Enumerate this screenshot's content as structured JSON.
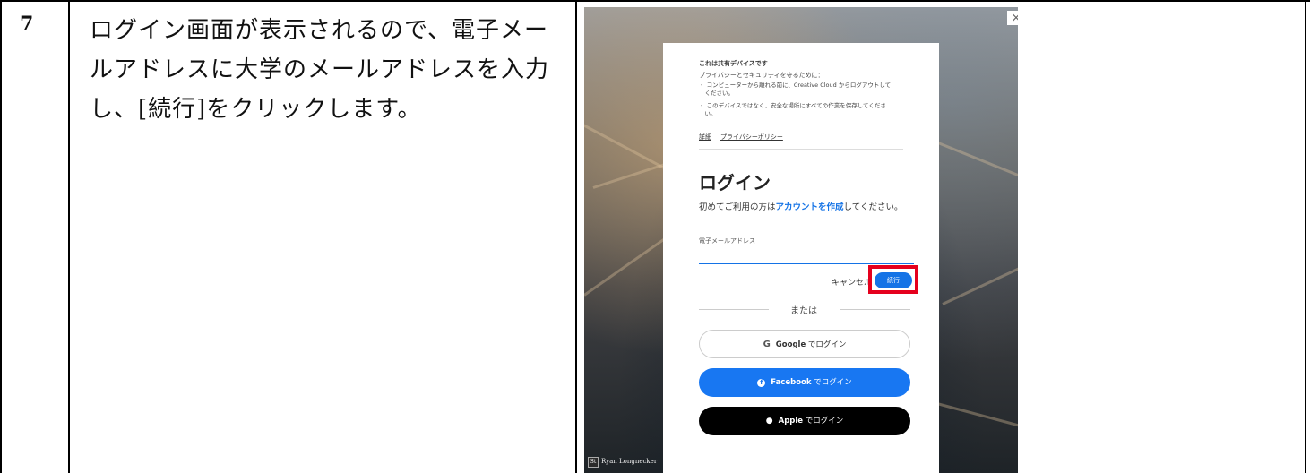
{
  "step": {
    "number": "7",
    "text": "ログイン画面が表示されるので、電子メー\nルアドレスに大学のメールアドレスを入力\nし、[続行]をクリックします。"
  },
  "screenshot": {
    "close_icon": "close-icon",
    "notice": {
      "title": "これは共有デバイスです",
      "subtitle": "プライバシーとセキュリティを守るために：",
      "bullet1": "・ コンピューターから離れる前に、Creative Cloud からログアウトして\n　ください。",
      "bullet2": "・ このデバイスではなく、安全な場所にすべての作業を保存してくださ\n　い。",
      "link_details": "詳細",
      "link_privacy": "プライバシーポリシー"
    },
    "login": {
      "title": "ログイン",
      "hint_prefix": "初めてご利用の方は",
      "hint_link": "アカウントを作成",
      "hint_suffix": "してください。",
      "email_label": "電子メールアドレス",
      "email_value": "",
      "cancel_label": "キャンセル",
      "continue_label": "続行",
      "or_label": "または",
      "google_brand": "Google",
      "google_suffix": " でログイン",
      "facebook_brand": "Facebook",
      "facebook_suffix": " でログイン",
      "apple_brand": "Apple",
      "apple_suffix": " でログイン"
    },
    "photo_credit": "Ryan Longnecker",
    "photo_credit_badge": "St",
    "colors": {
      "accent": "#1473e6",
      "highlight": "#e5001d",
      "facebook": "#1877f2",
      "apple": "#000000"
    }
  }
}
